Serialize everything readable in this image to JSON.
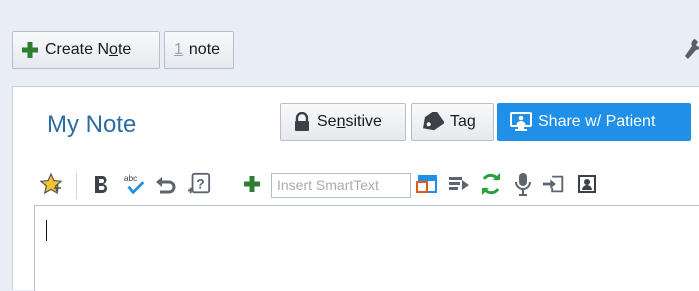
{
  "header": {
    "create_note_label": "Create Note",
    "create_note_parts": [
      "Create N",
      "o",
      "te"
    ],
    "note_count_number": "1",
    "note_count_suffix": "note"
  },
  "note": {
    "title": "My Note",
    "sensitive_parts": [
      "Se",
      "n",
      "sitive"
    ],
    "tag_parts": [
      "Ta",
      "g"
    ],
    "share_label": "Share w/ Patient"
  },
  "toolbar": {
    "icons": [
      "favorite-star-icon",
      "bold-icon",
      "spellcheck-icon",
      "undo-icon",
      "help-question-icon",
      "add-icon",
      "insert-smarttext-icon",
      "smartlink-icon",
      "refresh-icon",
      "microphone-icon",
      "import-icon",
      "image-icon"
    ],
    "smarttext_placeholder": "Insert SmartText"
  },
  "colors": {
    "accent_blue": "#1f8fe8",
    "title_blue": "#2e6ca4",
    "plus_green": "#2e7d32",
    "refresh_green": "#2e9e3a",
    "icon_gray": "#5c6570"
  }
}
